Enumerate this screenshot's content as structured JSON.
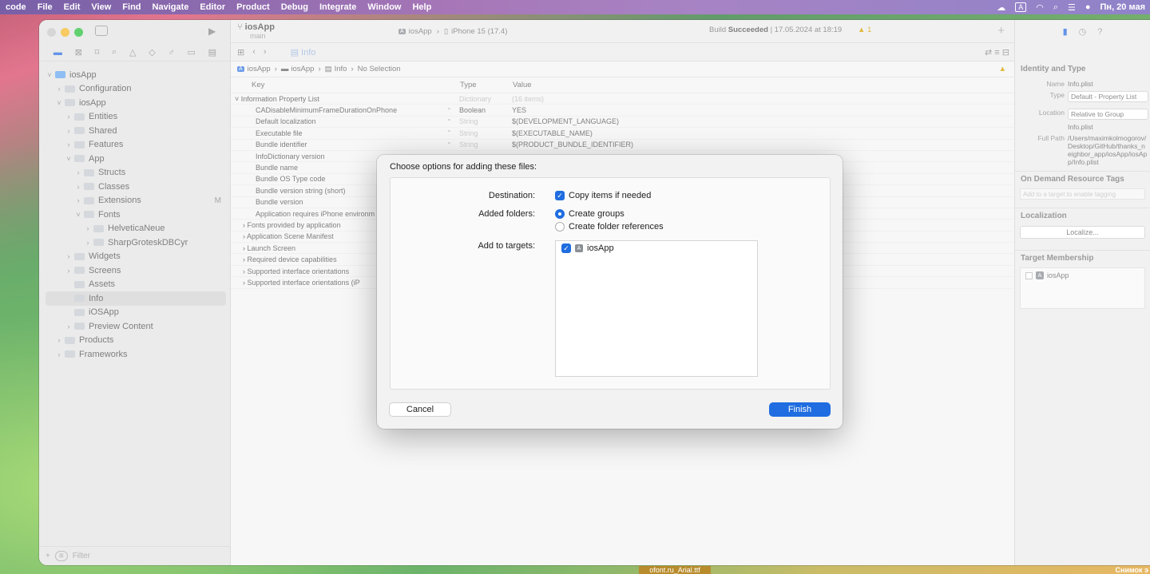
{
  "menubar": {
    "app": "code",
    "items": [
      "File",
      "Edit",
      "View",
      "Find",
      "Navigate",
      "Editor",
      "Product",
      "Debug",
      "Integrate",
      "Window",
      "Help"
    ],
    "keyboard": "A",
    "datetime": "Пн, 20 мая"
  },
  "toolbar": {
    "project": "iosApp",
    "branch": "main",
    "scheme": "iosApp",
    "device": "iPhone 15 (17.4)",
    "build_status_prefix": "Build",
    "build_status": "Succeeded",
    "build_date": "| 17.05.2024 at 18:19",
    "warnings": "1"
  },
  "editor": {
    "tab": "Info",
    "breadcrumb": [
      "iosApp",
      "iosApp",
      "Info",
      "No Selection"
    ],
    "warning_badge": "▲"
  },
  "navigator": {
    "filter_placeholder": "Filter",
    "items": [
      {
        "label": "iosApp",
        "depth": 0,
        "chev": "˅",
        "blue": true,
        "sel": false,
        "badge": ""
      },
      {
        "label": "Configuration",
        "depth": 1,
        "chev": "›",
        "blue": false,
        "sel": false,
        "badge": ""
      },
      {
        "label": "iosApp",
        "depth": 1,
        "chev": "˅",
        "blue": false,
        "sel": false,
        "badge": ""
      },
      {
        "label": "Entities",
        "depth": 2,
        "chev": "›",
        "blue": false,
        "sel": false,
        "badge": ""
      },
      {
        "label": "Shared",
        "depth": 2,
        "chev": "›",
        "blue": false,
        "sel": false,
        "badge": ""
      },
      {
        "label": "Features",
        "depth": 2,
        "chev": "›",
        "blue": false,
        "sel": false,
        "badge": ""
      },
      {
        "label": "App",
        "depth": 2,
        "chev": "˅",
        "blue": false,
        "sel": false,
        "badge": ""
      },
      {
        "label": "Structs",
        "depth": 3,
        "chev": "›",
        "blue": false,
        "sel": false,
        "badge": ""
      },
      {
        "label": "Classes",
        "depth": 3,
        "chev": "›",
        "blue": false,
        "sel": false,
        "badge": ""
      },
      {
        "label": "Extensions",
        "depth": 3,
        "chev": "›",
        "blue": false,
        "sel": false,
        "badge": "M"
      },
      {
        "label": "Fonts",
        "depth": 3,
        "chev": "˅",
        "blue": false,
        "sel": false,
        "badge": ""
      },
      {
        "label": "HelveticaNeue",
        "depth": 4,
        "chev": "›",
        "blue": false,
        "sel": false,
        "badge": ""
      },
      {
        "label": "SharpGroteskDBCyr",
        "depth": 4,
        "chev": "›",
        "blue": false,
        "sel": false,
        "badge": ""
      },
      {
        "label": "Widgets",
        "depth": 2,
        "chev": "›",
        "blue": false,
        "sel": false,
        "badge": ""
      },
      {
        "label": "Screens",
        "depth": 2,
        "chev": "›",
        "blue": false,
        "sel": false,
        "badge": ""
      },
      {
        "label": "Assets",
        "depth": 2,
        "chev": "",
        "blue": false,
        "sel": false,
        "badge": ""
      },
      {
        "label": "Info",
        "depth": 2,
        "chev": "",
        "blue": false,
        "sel": true,
        "badge": ""
      },
      {
        "label": "iOSApp",
        "depth": 2,
        "chev": "",
        "blue": false,
        "sel": false,
        "badge": ""
      },
      {
        "label": "Preview Content",
        "depth": 2,
        "chev": "›",
        "blue": false,
        "sel": false,
        "badge": ""
      },
      {
        "label": "Products",
        "depth": 1,
        "chev": "›",
        "blue": false,
        "sel": false,
        "badge": ""
      },
      {
        "label": "Frameworks",
        "depth": 1,
        "chev": "›",
        "blue": false,
        "sel": false,
        "badge": ""
      }
    ]
  },
  "plist": {
    "headers": {
      "key": "Key",
      "type": "Type",
      "value": "Value"
    },
    "rows": [
      {
        "key": "˅ Information Property List",
        "type": "Dictionary",
        "value": "(16 items)",
        "cls": "root",
        "tdark": false,
        "vdim": true,
        "stepper": ""
      },
      {
        "key": "CADisableMinimumFrameDurationOnPhone",
        "type": "Boolean",
        "value": "YES",
        "cls": "",
        "tdark": true,
        "vdim": false,
        "stepper": "⌃"
      },
      {
        "key": "Default localization",
        "type": "String",
        "value": "$(DEVELOPMENT_LANGUAGE)",
        "cls": "",
        "tdark": false,
        "vdim": false,
        "stepper": "⌃"
      },
      {
        "key": "Executable file",
        "type": "String",
        "value": "$(EXECUTABLE_NAME)",
        "cls": "",
        "tdark": false,
        "vdim": false,
        "stepper": "⌃"
      },
      {
        "key": "Bundle identifier",
        "type": "String",
        "value": "$(PRODUCT_BUNDLE_IDENTIFIER)",
        "cls": "",
        "tdark": false,
        "vdim": false,
        "stepper": "⌃"
      },
      {
        "key": "InfoDictionary version",
        "type": "",
        "value": "",
        "cls": "",
        "tdark": false,
        "vdim": false,
        "stepper": ""
      },
      {
        "key": "Bundle name",
        "type": "",
        "value": "",
        "cls": "",
        "tdark": false,
        "vdim": false,
        "stepper": ""
      },
      {
        "key": "Bundle OS Type code",
        "type": "",
        "value": "",
        "cls": "",
        "tdark": false,
        "vdim": false,
        "stepper": ""
      },
      {
        "key": "Bundle version string (short)",
        "type": "",
        "value": "",
        "cls": "",
        "tdark": false,
        "vdim": false,
        "stepper": ""
      },
      {
        "key": "Bundle version",
        "type": "",
        "value": "",
        "cls": "",
        "tdark": false,
        "vdim": false,
        "stepper": ""
      },
      {
        "key": "Application requires iPhone environm",
        "type": "",
        "value": "",
        "cls": "",
        "tdark": false,
        "vdim": false,
        "stepper": ""
      },
      {
        "key": "›  Fonts provided by application",
        "type": "",
        "value": "",
        "cls": "exp",
        "tdark": false,
        "vdim": false,
        "stepper": ""
      },
      {
        "key": "›  Application Scene Manifest",
        "type": "",
        "value": "",
        "cls": "exp",
        "tdark": false,
        "vdim": false,
        "stepper": ""
      },
      {
        "key": "›  Launch Screen",
        "type": "",
        "value": "",
        "cls": "exp",
        "tdark": false,
        "vdim": false,
        "stepper": ""
      },
      {
        "key": "›  Required device capabilities",
        "type": "",
        "value": "",
        "cls": "exp",
        "tdark": false,
        "vdim": false,
        "stepper": ""
      },
      {
        "key": "›  Supported interface orientations",
        "type": "",
        "value": "",
        "cls": "exp",
        "tdark": false,
        "vdim": false,
        "stepper": ""
      },
      {
        "key": "›  Supported interface orientations (iP",
        "type": "",
        "value": "",
        "cls": "exp",
        "tdark": false,
        "vdim": false,
        "stepper": ""
      }
    ]
  },
  "inspector": {
    "identity_title": "Identity and Type",
    "name_label": "Name",
    "name_value": "Info.plist",
    "type_label": "Type",
    "type_value": "Default - Property List",
    "location_label": "Location",
    "location_value": "Relative to Group",
    "location_file": "Info.plist",
    "fullpath_label": "Full Path",
    "fullpath_value": "/Users/maximkolmogorov/Desktop/GitHub/thanks_neighbor_app/iosApp/iosApp/Info.plist",
    "odr_title": "On Demand Resource Tags",
    "odr_placeholder": "Add to a target to enable tagging",
    "loc_title": "Localization",
    "localize_button": "Localize...",
    "membership_title": "Target Membership",
    "membership_target": "iosApp"
  },
  "dialog": {
    "title": "Choose options for adding these files:",
    "destination_label": "Destination:",
    "copy_items": "Copy items if needed",
    "added_folders_label": "Added folders:",
    "create_groups": "Create groups",
    "create_folder_refs": "Create folder references",
    "add_to_targets_label": "Add to targets:",
    "target_name": "iosApp",
    "cancel": "Cancel",
    "finish": "Finish"
  },
  "dock": {
    "item": "ofont.ru_Arial.ttf",
    "screenshot_label": "Снимок э"
  }
}
